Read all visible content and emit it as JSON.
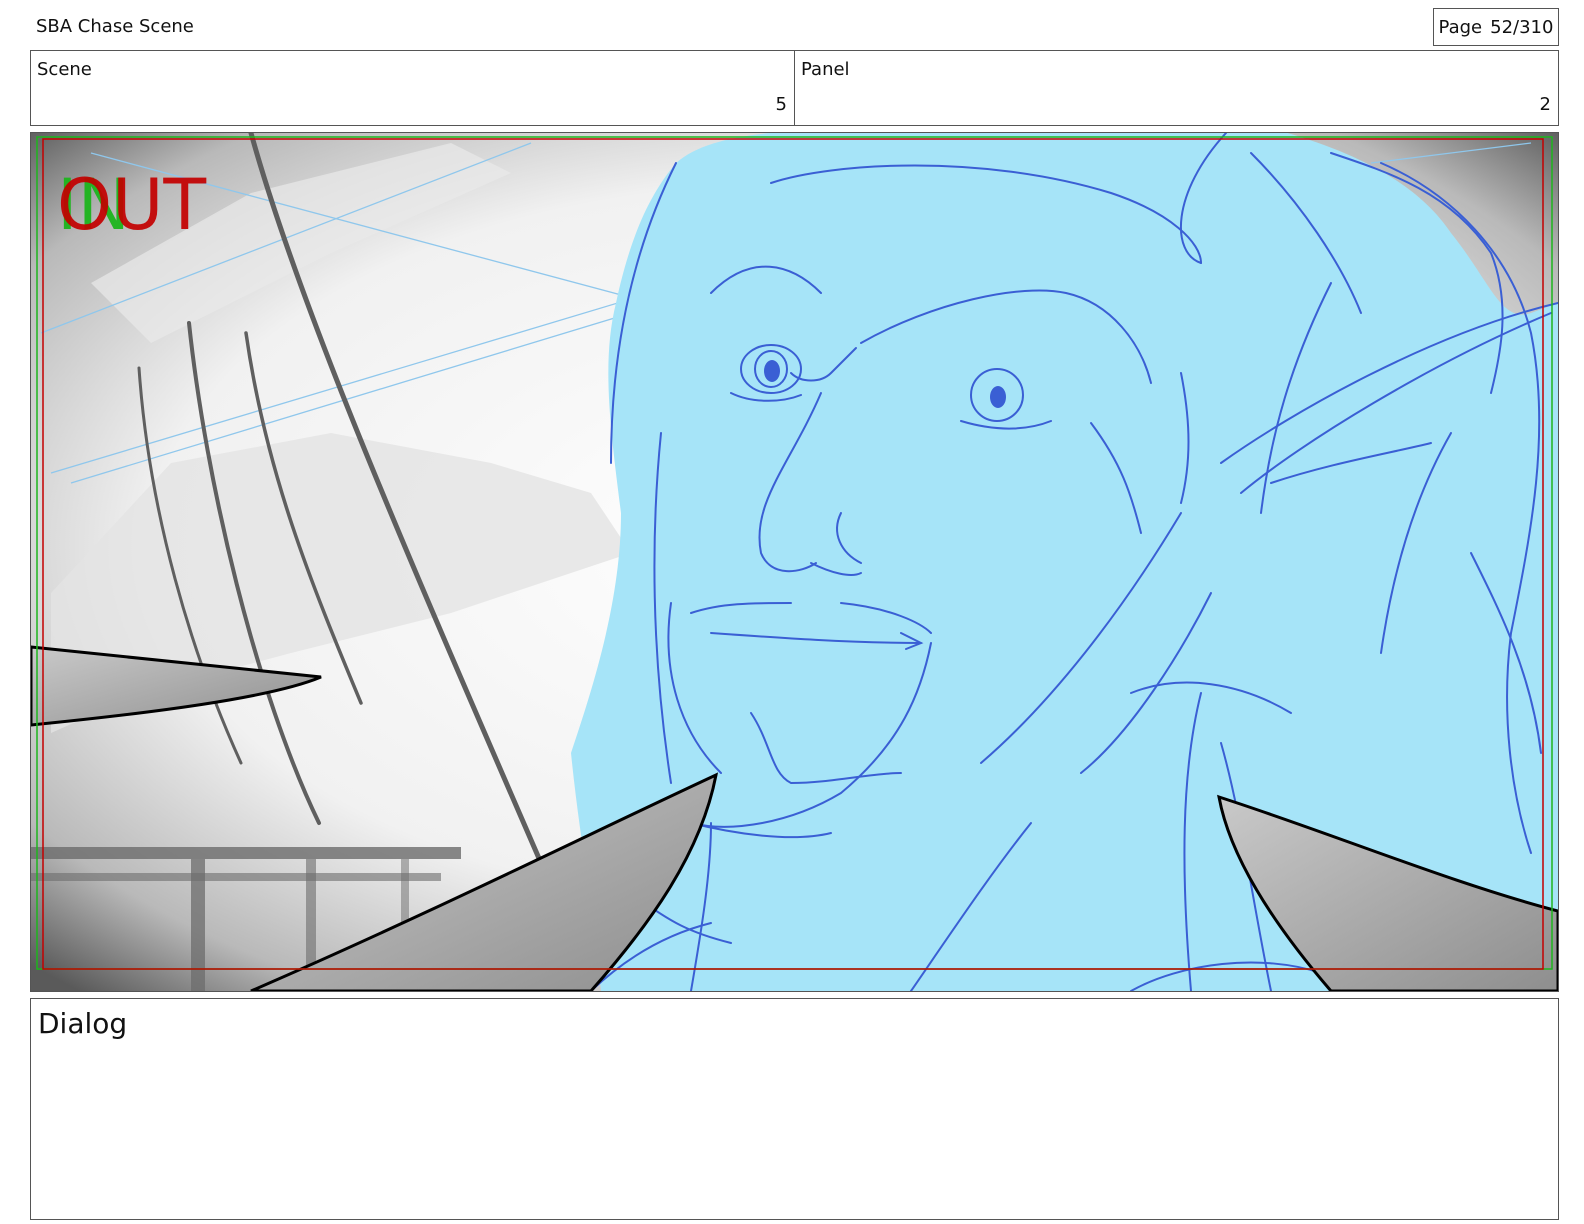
{
  "header": {
    "project_title": "SBA Chase Scene",
    "page_label": "Page",
    "page_number": "52/310"
  },
  "scene": {
    "label": "Scene",
    "value": "5"
  },
  "panel": {
    "label": "Panel",
    "value": "2"
  },
  "frame": {
    "marker_in": "IN",
    "marker_out": "OUT",
    "marker_in_color": "#1db51d",
    "marker_out_color": "#c40000",
    "safe_frame_color": "#c40000",
    "sketch_fill_color": "#a6e4f8",
    "sketch_line_color": "#3a5fd4",
    "blade_fill_color": "#a8a8a8"
  },
  "dialog": {
    "label": "Dialog",
    "text": ""
  }
}
